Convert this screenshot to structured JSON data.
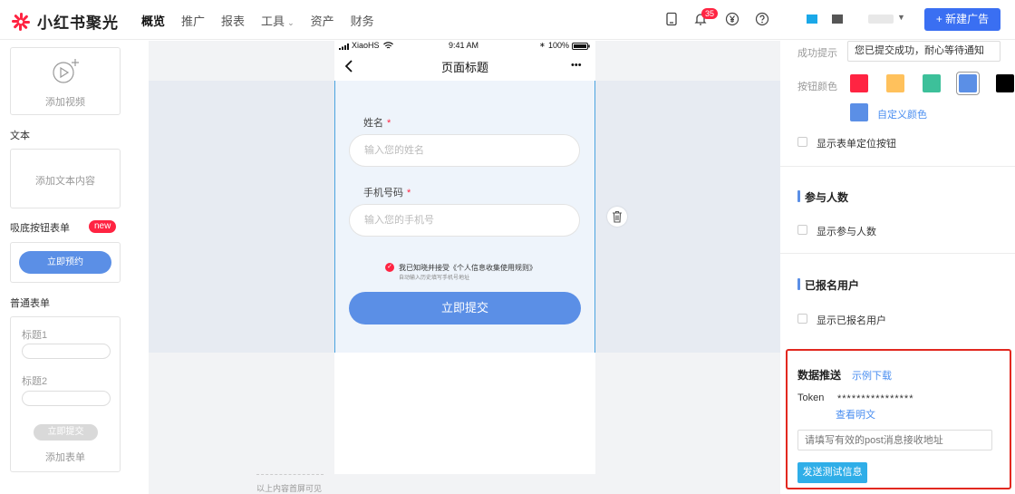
{
  "brand": {
    "name": "小红书聚光",
    "color": "#ff2442"
  },
  "nav": {
    "items": [
      {
        "label": "概览",
        "active": true
      },
      {
        "label": "推广",
        "active": false
      },
      {
        "label": "报表",
        "active": false
      },
      {
        "label": "工具",
        "active": false,
        "has_dropdown": true
      },
      {
        "label": "资产",
        "active": false
      },
      {
        "label": "财务",
        "active": false
      }
    ]
  },
  "topbar": {
    "notification_count": "35",
    "new_ad_button": "+ 新建广告",
    "icons": [
      "tablet-icon",
      "bell-icon",
      "yen-icon",
      "help-icon"
    ],
    "account_colors": [
      "#1aa8e8",
      "#555555"
    ]
  },
  "left_panel": {
    "video_card": {
      "label": "添加视频"
    },
    "text_section": {
      "title": "文本",
      "placeholder": "添加文本内容"
    },
    "sticky_button_section": {
      "title": "吸底按钮表单",
      "tag": "new",
      "button": "立即预约"
    },
    "form_section": {
      "title": "普通表单",
      "field1": "标题1",
      "field2": "标题2",
      "submit": "立即提交",
      "add_label": "添加表单"
    }
  },
  "phone": {
    "status_carrier": "XiaoHS",
    "status_time": "9:41 AM",
    "status_battery": "100%",
    "title": "页面标题",
    "more": "•••",
    "fields": [
      {
        "label": "姓名",
        "required_mark": "*",
        "placeholder": "输入您的姓名"
      },
      {
        "label": "手机号码",
        "required_mark": "*",
        "placeholder": "输入您的手机号"
      }
    ],
    "agreement": "我已知晓并接受《个人信息收集使用规则》",
    "agreement_sub": "自动输入历史填写手机号地址",
    "submit": "立即提交",
    "fold_note": "以上内容首屏可见"
  },
  "right_panel": {
    "success_label": "成功提示",
    "success_value": "您已提交成功，耐心等待通知",
    "button_color_label": "按钮颜色",
    "swatches": [
      "#ff2442",
      "#ffc15c",
      "#3dc09a",
      "#5b8fe6",
      "#000000"
    ],
    "selected_swatch": 3,
    "custom_color_swatch": "#5b8fe6",
    "custom_color_link": "自定义颜色",
    "show_locate_btn": "显示表单定位按钮",
    "participants_title": "参与人数",
    "show_participants": "显示参与人数",
    "registered_title": "已报名用户",
    "show_registered": "显示已报名用户",
    "push": {
      "title": "数据推送",
      "example_link": "示例下载",
      "token_label": "Token",
      "token_value": "****************",
      "view_plain": "查看明文",
      "url_placeholder": "请填写有效的post消息接收地址",
      "send_button": "发送测试信息"
    }
  }
}
